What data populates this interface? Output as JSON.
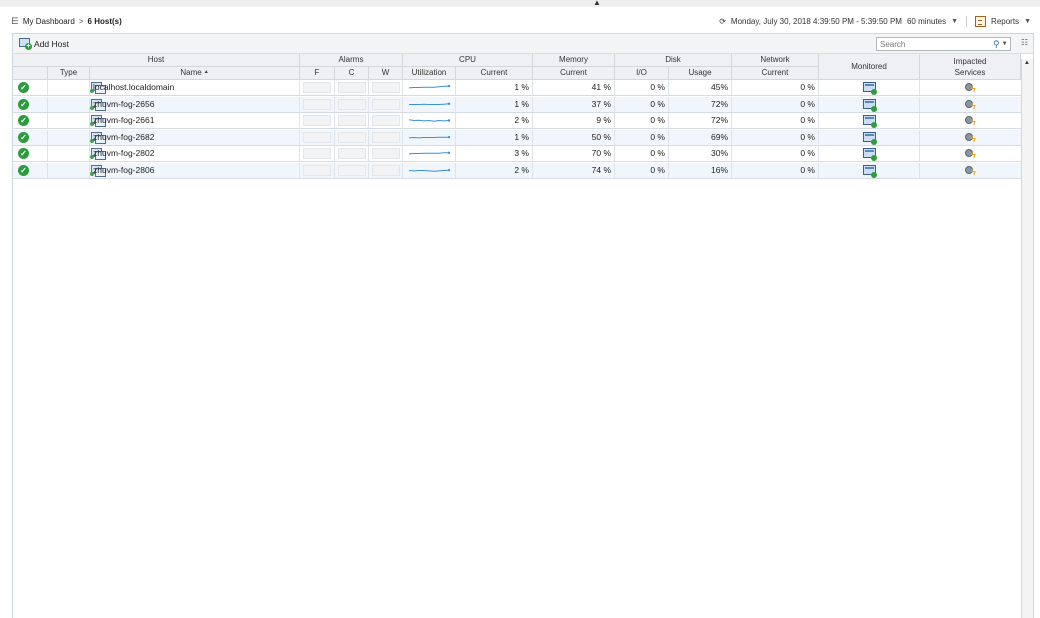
{
  "breadcrumb": {
    "home_label": "My Dashboard",
    "separator": ">",
    "current": "6 Host(s)"
  },
  "timebar": {
    "range": "Monday, July 30, 2018 4:39:50 PM - 5:39:50 PM",
    "duration": "60 minutes",
    "reports_label": "Reports"
  },
  "toolbar": {
    "add_host_label": "Add Host",
    "search_placeholder": "Search"
  },
  "headers": {
    "group_host": "Host",
    "group_alarms": "Alarms",
    "group_cpu": "CPU",
    "group_memory": "Memory",
    "group_disk": "Disk",
    "group_network": "Network",
    "monitored": "Monitored",
    "impacted_line1": "Impacted",
    "impacted_line2": "Services",
    "type": "Type",
    "name": "Name",
    "alarm_f": "F",
    "alarm_c": "C",
    "alarm_w": "W",
    "utilization": "Utilization",
    "cpu_current": "Current",
    "mem_current": "Current",
    "disk_io": "I/O",
    "disk_usage": "Usage",
    "net_current": "Current"
  },
  "rows": [
    {
      "name": "localhost.localdomain",
      "cpu": "1 %",
      "mem": "41 %",
      "io": "0 %",
      "usage": "45%",
      "net": "0 %",
      "spark": [
        0.55,
        0.5,
        0.5,
        0.45,
        0.45,
        0.45,
        0.4,
        0.35,
        0.3
      ]
    },
    {
      "name": "zhuvm-fog-2656",
      "cpu": "1 %",
      "mem": "37 %",
      "io": "0 %",
      "usage": "72%",
      "net": "0 %",
      "spark": [
        0.5,
        0.5,
        0.5,
        0.45,
        0.5,
        0.5,
        0.5,
        0.45,
        0.4
      ]
    },
    {
      "name": "zhuvm-fog-2661",
      "cpu": "2 %",
      "mem": "9 %",
      "io": "0 %",
      "usage": "72%",
      "net": "0 %",
      "spark": [
        0.4,
        0.5,
        0.45,
        0.55,
        0.5,
        0.6,
        0.5,
        0.55,
        0.5
      ]
    },
    {
      "name": "zhuvm-fog-2682",
      "cpu": "1 %",
      "mem": "50 %",
      "io": "0 %",
      "usage": "69%",
      "net": "0 %",
      "spark": [
        0.55,
        0.5,
        0.55,
        0.5,
        0.5,
        0.5,
        0.45,
        0.45,
        0.45
      ]
    },
    {
      "name": "zhuvm-fog-2802",
      "cpu": "3 %",
      "mem": "70 %",
      "io": "0 %",
      "usage": "30%",
      "net": "0 %",
      "spark": [
        0.55,
        0.5,
        0.5,
        0.45,
        0.45,
        0.45,
        0.45,
        0.4,
        0.4
      ]
    },
    {
      "name": "zhuvm-fog-2806",
      "cpu": "2 %",
      "mem": "74 %",
      "io": "0 %",
      "usage": "16%",
      "net": "0 %",
      "spark": [
        0.5,
        0.55,
        0.5,
        0.5,
        0.55,
        0.6,
        0.55,
        0.5,
        0.45
      ]
    }
  ],
  "colors": {
    "status_ok": "#2c9b3d",
    "sparkline": "#3a8fd6"
  }
}
